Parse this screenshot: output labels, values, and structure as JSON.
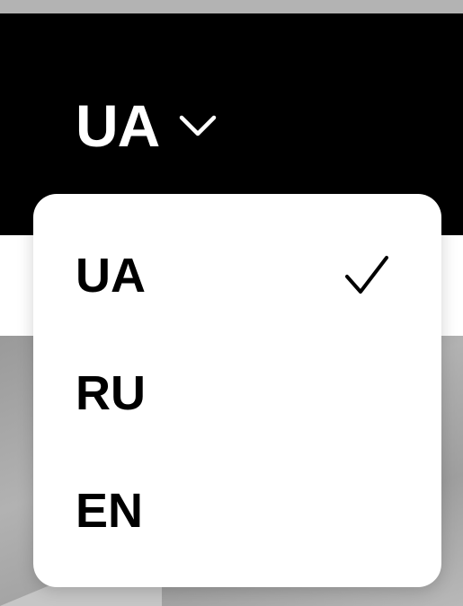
{
  "header": {
    "language_toggle": {
      "current": "UA",
      "chevron_icon": "chevron-down-icon"
    }
  },
  "dropdown": {
    "options": [
      {
        "label": "UA",
        "selected": true,
        "check_icon": "checkmark-icon"
      },
      {
        "label": "RU",
        "selected": false
      },
      {
        "label": "EN",
        "selected": false
      }
    ]
  },
  "colors": {
    "header_background": "#000000",
    "header_text": "#ffffff",
    "dropdown_background": "#ffffff",
    "option_text": "#000000"
  }
}
